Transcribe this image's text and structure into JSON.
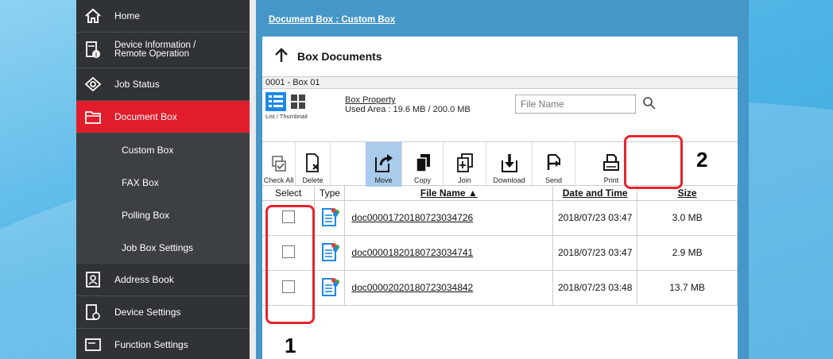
{
  "sidebar": {
    "items": [
      {
        "label": "Home",
        "icon": "home-icon"
      },
      {
        "label": "Device Information /",
        "label2": "Remote Operation",
        "icon": "device-info-icon"
      },
      {
        "label": "Job Status",
        "icon": "eye-icon"
      },
      {
        "label": "Document Box",
        "icon": "folder-icon"
      }
    ],
    "subitems": [
      "Custom Box",
      "FAX Box",
      "Polling Box",
      "Job Box Settings"
    ],
    "bottom": [
      {
        "label": "Address Book",
        "icon": "address-book-icon"
      },
      {
        "label": "Device Settings",
        "icon": "device-settings-icon"
      },
      {
        "label": "Function Settings",
        "icon": "function-settings-icon"
      }
    ]
  },
  "breadcrumb": "Document Box : Custom Box",
  "panel": {
    "title": "Box Documents",
    "box_name": "0001 - Box 01",
    "view_toggle_label": "List / Thumbnail",
    "box_property_link": "Box Property",
    "used_area": "Used Area : 19.6 MB / 200.0 MB",
    "file_name_placeholder": "File Name"
  },
  "toolbar": [
    {
      "label": "Check All",
      "icon": "check-all-icon"
    },
    {
      "label": "Delete",
      "icon": "delete-icon"
    },
    {
      "label": "Move",
      "icon": "move-icon"
    },
    {
      "label": "Copy",
      "icon": "copy-icon"
    },
    {
      "label": "Join",
      "icon": "join-icon"
    },
    {
      "label": "Download",
      "icon": "download-icon"
    },
    {
      "label": "Send",
      "icon": "send-icon"
    },
    {
      "label": "Print",
      "icon": "print-icon"
    }
  ],
  "table": {
    "headers": [
      "Select",
      "Type",
      "File Name ▲",
      "Date and Time",
      "Size"
    ],
    "rows": [
      {
        "name": "doc00001720180723034726",
        "date": "2018/07/23 03:47",
        "size": "3.0 MB"
      },
      {
        "name": "doc00001820180723034741",
        "date": "2018/07/23 03:47",
        "size": "2.9 MB"
      },
      {
        "name": "doc00002020180723034842",
        "date": "2018/07/23 03:48",
        "size": "13.7 MB"
      }
    ]
  },
  "callouts": {
    "one": "1",
    "two": "2"
  },
  "colors": {
    "sidebar_bg": "#2f3335",
    "active": "#e11d2b",
    "main_bg": "#4696c8",
    "highlight": "#e8232e",
    "move_active": "#a9ccec"
  }
}
